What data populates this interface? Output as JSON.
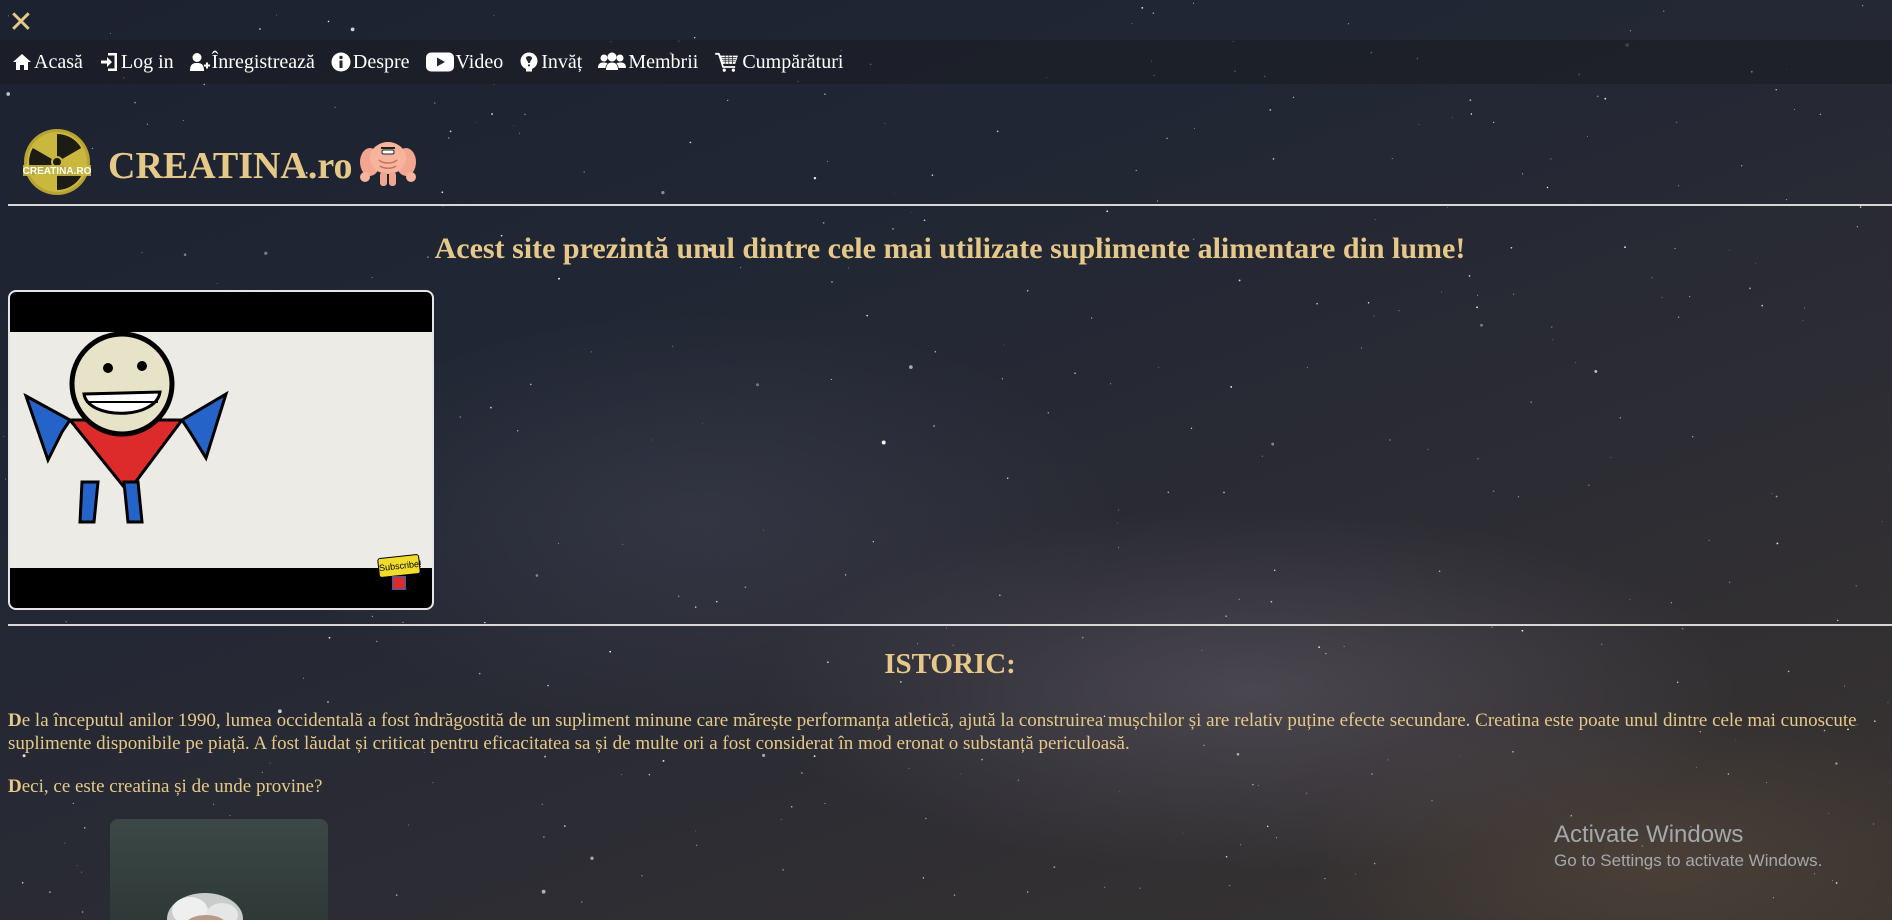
{
  "window": {
    "close_glyph": "✕",
    "close_icon": "close-icon"
  },
  "nav": {
    "items": [
      {
        "label": "Acasă",
        "icon": "home-icon"
      },
      {
        "label": "Log in",
        "icon": "login-icon"
      },
      {
        "label": "Înregistrează",
        "icon": "add-user-icon"
      },
      {
        "label": "Despre",
        "icon": "info-icon"
      },
      {
        "label": "Video",
        "icon": "youtube-icon"
      },
      {
        "label": "Invăț",
        "icon": "lightbulb-icon"
      },
      {
        "label": "Membrii",
        "icon": "users-icon"
      },
      {
        "label": "Cumpărături",
        "icon": "cart-icon"
      }
    ]
  },
  "header": {
    "site_name": "CREATINA.ro",
    "logo_text": "CREATINA.RO",
    "logo_icon": "radiation-logo",
    "mascot_icon": "muscle-mascot-icon"
  },
  "tagline": "Acest site prezintă unul dintre cele mai utilizate suplimente alimentare din lume!",
  "video": {
    "thumbnail": "stick-figure-video-thumbnail",
    "badge_text": "Subscribe!"
  },
  "section": {
    "title": "ISTORIC:",
    "p1_initial": "D",
    "p1_text": "e la începutul anilor 1990, lumea occidentală a fost îndrăgostită de un supliment minune care mărește performanța atletică, ajută la construirea mușchilor și are relativ puține efecte secundare. Creatina este poate unul dintre cele mai cunoscute suplimente disponibile pe piață. A fost lăudat și criticat pentru eficacitatea sa și de multe ori a fost considerat în mod eronat o substanță periculoasă.",
    "p2_initial": "D",
    "p2_text": "eci, ce este creatina și de unde provine?",
    "image": "scientist-portrait"
  },
  "watermark": {
    "title": "Activate Windows",
    "subtitle": "Go to Settings to activate Windows."
  },
  "colors": {
    "accent_gold": "#e6c988",
    "nav_text": "#ffffff",
    "divider": "#d7d7d7",
    "watermark": "#a5a7ad"
  }
}
